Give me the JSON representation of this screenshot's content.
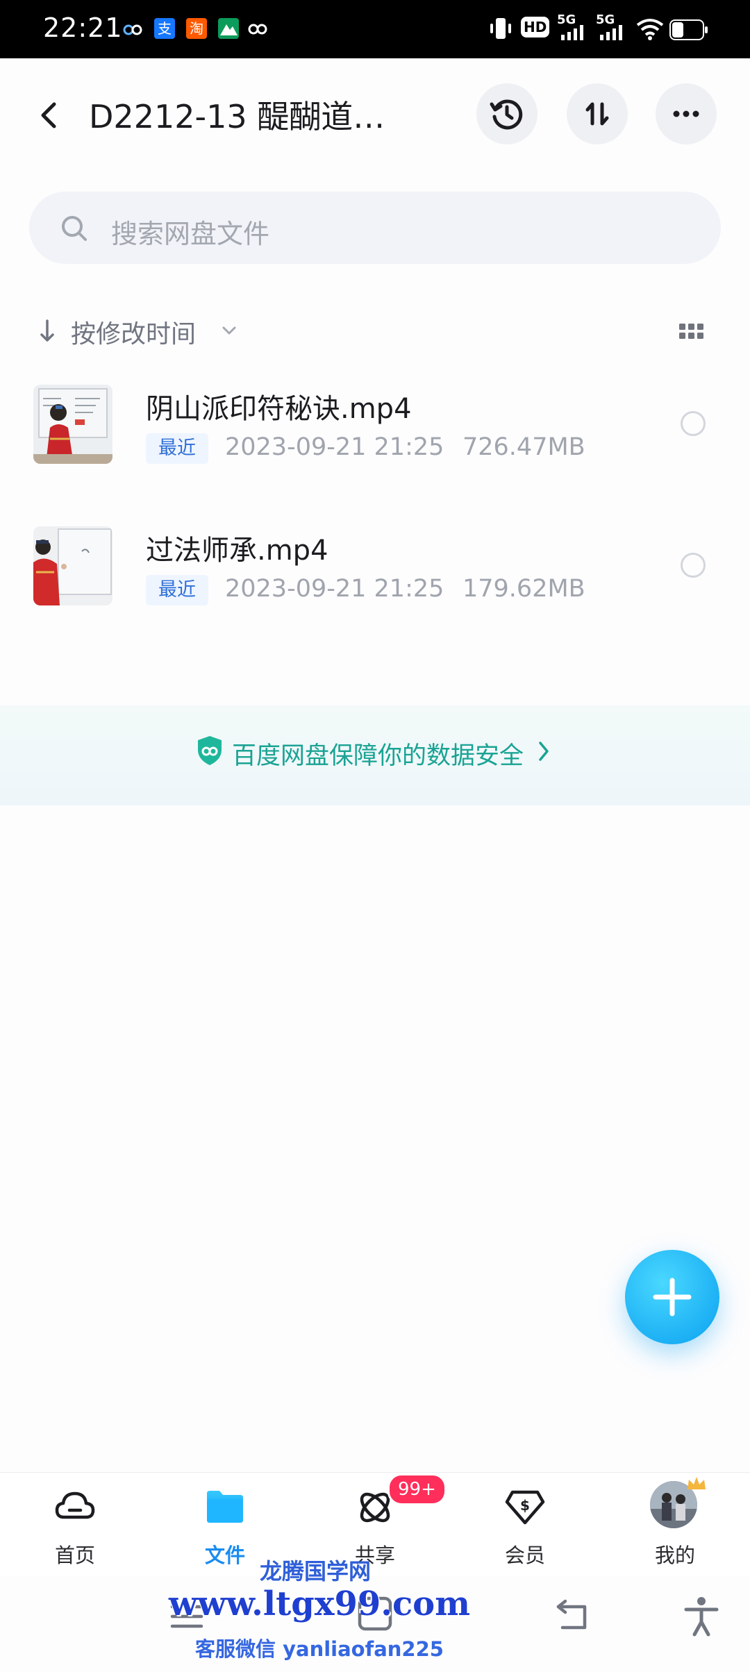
{
  "status": {
    "time": "22:21",
    "apps": [
      "百",
      "支",
      "淘",
      "山",
      "云"
    ],
    "network_hd": "HD",
    "sig1": "5G",
    "sig2": "5G"
  },
  "header": {
    "title": "D2212-13 醍醐道…"
  },
  "search": {
    "placeholder": "搜索网盘文件"
  },
  "sort": {
    "label": "按修改时间"
  },
  "files": [
    {
      "name": "阴山派印符秘诀.mp4",
      "tag": "最近",
      "datetime": "2023-09-21  21:25",
      "size": "726.47MB"
    },
    {
      "name": "过法师承.mp4",
      "tag": "最近",
      "datetime": "2023-09-21  21:25",
      "size": "179.62MB"
    }
  ],
  "security": {
    "text": "百度网盘保障你的数据安全"
  },
  "tabs": [
    {
      "label": "首页"
    },
    {
      "label": "文件"
    },
    {
      "label": "共享"
    },
    {
      "label": "会员"
    },
    {
      "label": "我的"
    }
  ],
  "share_badge": "99+",
  "watermark": {
    "line1": "龙腾国学网",
    "line2": "www.ltgx99.com",
    "line3": "客服微信 yanliaofan225"
  },
  "colors": {
    "accent": "#0aa0f0",
    "security_green": "#1aa394",
    "badge_red": "#ff2e5a",
    "active_tab": "#1a8cf0"
  }
}
